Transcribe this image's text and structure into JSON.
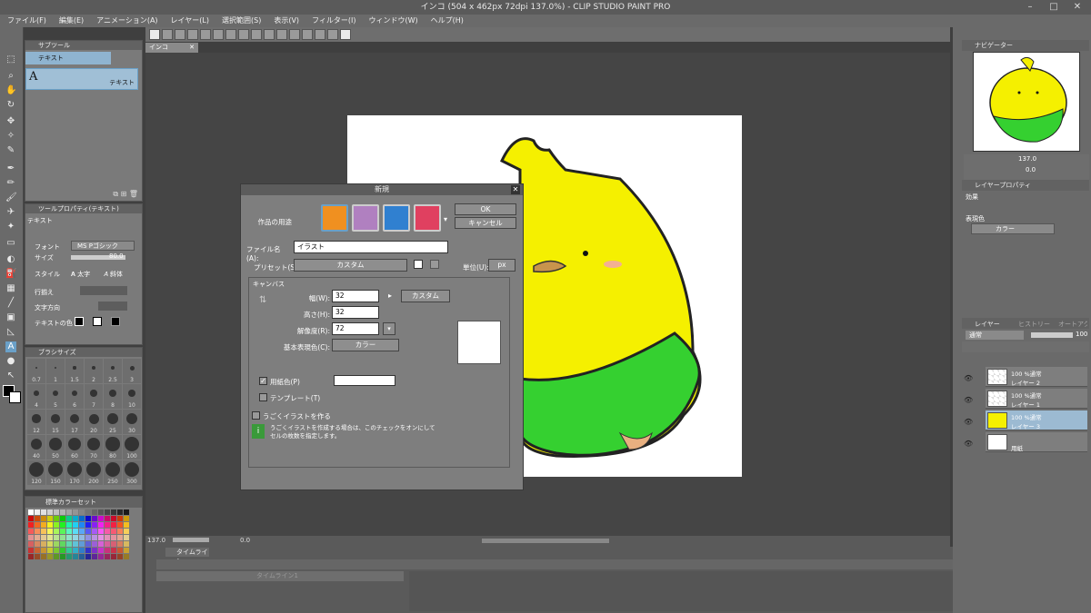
{
  "window": {
    "title": "インコ (504 x 462px 72dpi 137.0%) - CLIP STUDIO PAINT PRO"
  },
  "menu": [
    "ファイル(F)",
    "編集(E)",
    "アニメーション(A)",
    "レイヤー(L)",
    "選択範囲(S)",
    "表示(V)",
    "フィルター(I)",
    "ウィンドウ(W)",
    "ヘルプ(H)"
  ],
  "doc_tab": "インコ",
  "subtool": {
    "header": "サブツール",
    "tab": "テキスト",
    "item": "テキスト"
  },
  "toolprop": {
    "header": "ツールプロパティ(テキスト)",
    "tool": "テキスト",
    "font_label": "フォント",
    "font_value": "MS Pゴシック",
    "size_label": "サイズ",
    "size_value": "80.0",
    "style_label": "スタイル",
    "bold": "太字",
    "italic": "斜体",
    "align_label": "行揃え",
    "direction_label": "文字方向",
    "color_label": "テキストの色"
  },
  "brushsize": {
    "header": "ブラシサイズ",
    "values": [
      "0.7",
      "1",
      "1.5",
      "2",
      "2.5",
      "3",
      "4",
      "5",
      "6",
      "7",
      "8",
      "10",
      "12",
      "15",
      "17",
      "20",
      "25",
      "30",
      "40",
      "50",
      "60",
      "70",
      "80",
      "100",
      "120",
      "150",
      "170",
      "200",
      "250",
      "300"
    ]
  },
  "colorset": {
    "name": "標準カラーセット"
  },
  "dialog": {
    "title": "新規",
    "usage_label": "作品の用途",
    "ok": "OK",
    "cancel": "キャンセル",
    "filename_label": "ファイル名(A):",
    "filename_value": "イラスト",
    "preset_label": "プリセット(S):",
    "preset_value": "カスタム",
    "unit_label": "単位(U):",
    "unit_value": "px",
    "canvas_section": "キャンバス",
    "width_label": "幅(W):",
    "width_value": "32",
    "height_label": "高さ(H):",
    "height_value": "32",
    "size_preset": "カスタム",
    "resolution_label": "解像度(R):",
    "resolution_value": "72",
    "colormode_label": "基本表現色(C):",
    "colormode_value": "カラー",
    "paper_label": "用紙色(P)",
    "template_label": "テンプレート(T)",
    "anim_label": "うごくイラストを作る",
    "anim_note_1": "うごくイラストを作成する場合は、このチェックをオンにして",
    "anim_note_2": "セルの枚数を指定します。",
    "paper_checked": "✓"
  },
  "status": {
    "zoom": "137.0",
    "angle": "0.0"
  },
  "navigator": {
    "header": "ナビゲーター",
    "zoom": "137.0",
    "rot": "0.0"
  },
  "layerprop": {
    "header": "レイヤープロパティ",
    "effect": "効果",
    "color_label": "表現色",
    "color_value": "カラー"
  },
  "layers": {
    "tab": "レイヤー",
    "tab2": "ヒストリー",
    "tab3": "オートアクション",
    "blend": "通常",
    "opacity": "100",
    "items": [
      {
        "mode": "100 %通常",
        "name": "レイヤー 2"
      },
      {
        "mode": "100 %通常",
        "name": "レイヤー 1"
      },
      {
        "mode": "100 %通常",
        "name": "レイヤー 3"
      },
      {
        "mode": "",
        "name": "用紙"
      }
    ]
  },
  "timeline": {
    "header": "タイムライン",
    "track": "タイムライン1"
  },
  "colors": {
    "accent": "#6aa0c8",
    "bird_yellow": "#f5f000",
    "bird_green": "#35d030",
    "beak": "#c8944c",
    "toolbar": "#6e6e6e"
  }
}
